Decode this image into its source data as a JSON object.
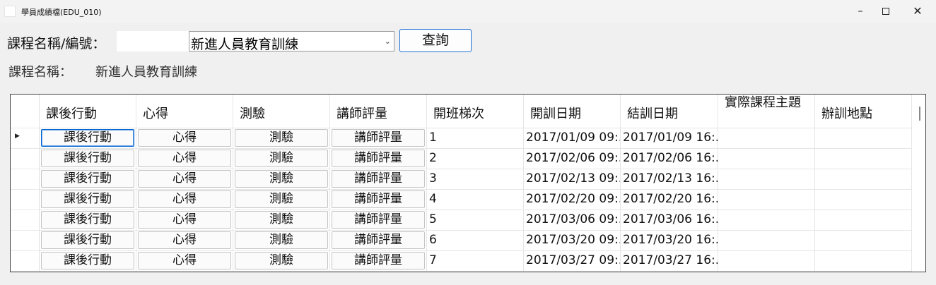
{
  "window": {
    "title": "學員成績檔(EDU_010)",
    "minimize_glyph": "–",
    "close_glyph": "✕"
  },
  "form": {
    "course_label": "課程名稱/編號：",
    "course_code": "",
    "course_selected": "新進人員教育訓練",
    "query_label": "查詢",
    "name_label": "課程名稱：",
    "name_value": "新進人員教育訓練"
  },
  "grid": {
    "columns": [
      "課後行動",
      "心得",
      "測驗",
      "講師評量",
      "開班梯次",
      "開訓日期",
      "結訓日期",
      "實際課程主題",
      "辦訓地點"
    ],
    "button_labels": [
      "課後行動",
      "心得",
      "測驗",
      "講師評量"
    ],
    "rows": [
      {
        "session": "1",
        "start": "2017/01/09 09:...",
        "end": "2017/01/09 16:...",
        "topic": "",
        "location": ""
      },
      {
        "session": "2",
        "start": "2017/02/06 09:...",
        "end": "2017/02/06 16:...",
        "topic": "",
        "location": ""
      },
      {
        "session": "3",
        "start": "2017/02/13 09:...",
        "end": "2017/02/13 16:...",
        "topic": "",
        "location": ""
      },
      {
        "session": "4",
        "start": "2017/02/20 09:...",
        "end": "2017/02/20 16:...",
        "topic": "",
        "location": ""
      },
      {
        "session": "5",
        "start": "2017/03/06 09:...",
        "end": "2017/03/06 16:...",
        "topic": "",
        "location": ""
      },
      {
        "session": "6",
        "start": "2017/03/20 09:...",
        "end": "2017/03/20 16:...",
        "topic": "",
        "location": ""
      },
      {
        "session": "7",
        "start": "2017/03/27 09:...",
        "end": "2017/03/27 16:...",
        "topic": "",
        "location": ""
      }
    ]
  }
}
